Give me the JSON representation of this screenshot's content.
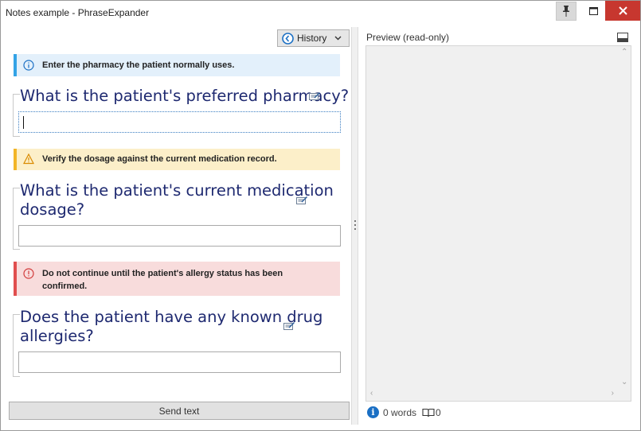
{
  "window": {
    "title": "Notes example - PhraseExpander"
  },
  "toolbar": {
    "history_label": "History"
  },
  "alerts": {
    "info": "Enter the pharmacy the patient normally uses.",
    "warning": "Verify the dosage against the current medication record.",
    "error_line1": "Do not continue until the patient's allergy status has been",
    "error_line2": "confirmed."
  },
  "questions": [
    {
      "line1": "What is the patient's preferred pharmacy?",
      "line2": "",
      "value": ""
    },
    {
      "line1": "What is the patient's current medication",
      "line2": "dosage?",
      "value": ""
    },
    {
      "line1": "Does the patient have any known drug",
      "line2": "allergies?",
      "value": ""
    }
  ],
  "footer": {
    "send_label": "Send text"
  },
  "preview": {
    "label": "Preview (read-only)",
    "word_count": "0 words",
    "book_count": "0"
  },
  "colors": {
    "question": "#1e2970",
    "info": "#33a3e6",
    "warning": "#f2b527",
    "error": "#e14e4e",
    "close": "#c7372f"
  }
}
